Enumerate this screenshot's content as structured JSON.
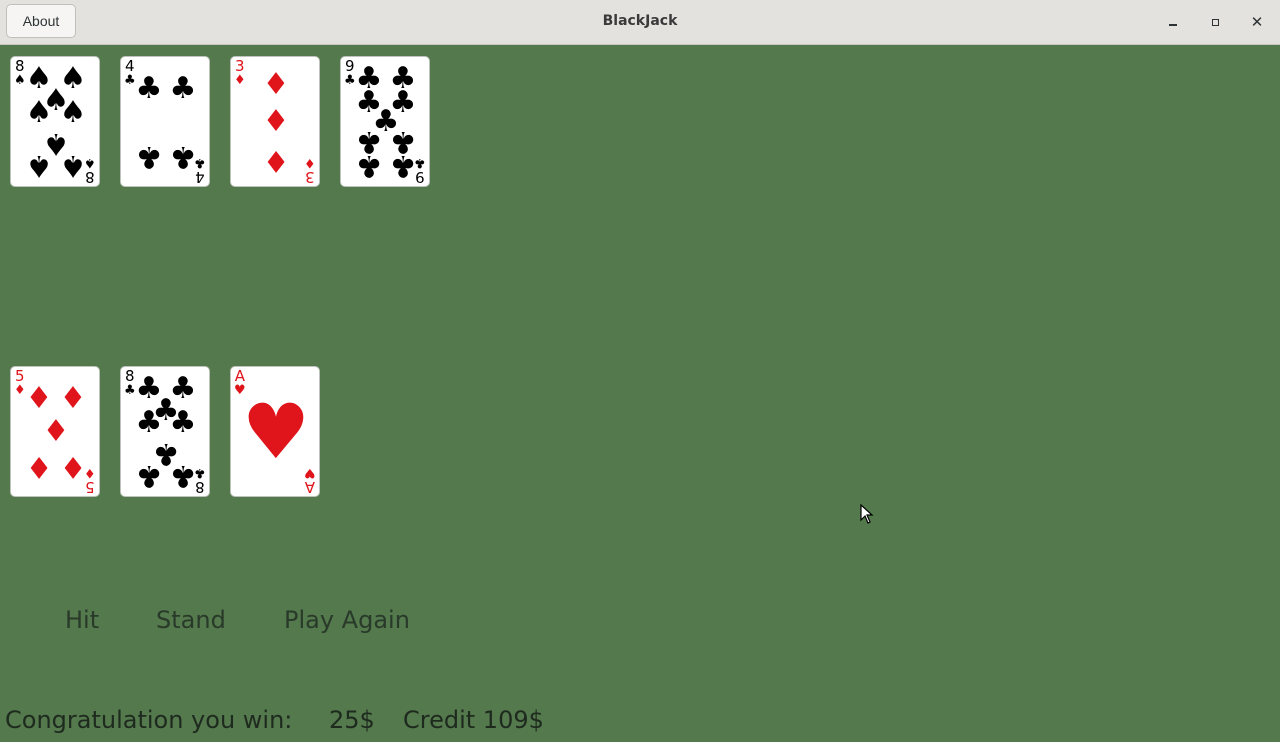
{
  "window": {
    "title": "BlackJack",
    "about_label": "About",
    "controls": {
      "minimize": "minimize-icon",
      "maximize": "maximize-icon",
      "close": "close-icon"
    }
  },
  "dealer_hand": [
    {
      "rank": "8",
      "suit": "♠",
      "color": "black"
    },
    {
      "rank": "4",
      "suit": "♣",
      "color": "black"
    },
    {
      "rank": "3",
      "suit": "♦",
      "color": "red"
    },
    {
      "rank": "9",
      "suit": "♣",
      "color": "black"
    }
  ],
  "player_hand": [
    {
      "rank": "5",
      "suit": "♦",
      "color": "red"
    },
    {
      "rank": "8",
      "suit": "♣",
      "color": "black"
    },
    {
      "rank": "A",
      "suit": "♥",
      "color": "red"
    }
  ],
  "actions": {
    "hit": "Hit",
    "stand": "Stand",
    "play_again": "Play Again"
  },
  "status": {
    "message": "Congratulation you win:",
    "amount": "25$",
    "credit": "Credit 109$"
  },
  "colors": {
    "table": "#53794c",
    "red_suit": "#e0141b",
    "black_suit": "#000000"
  }
}
